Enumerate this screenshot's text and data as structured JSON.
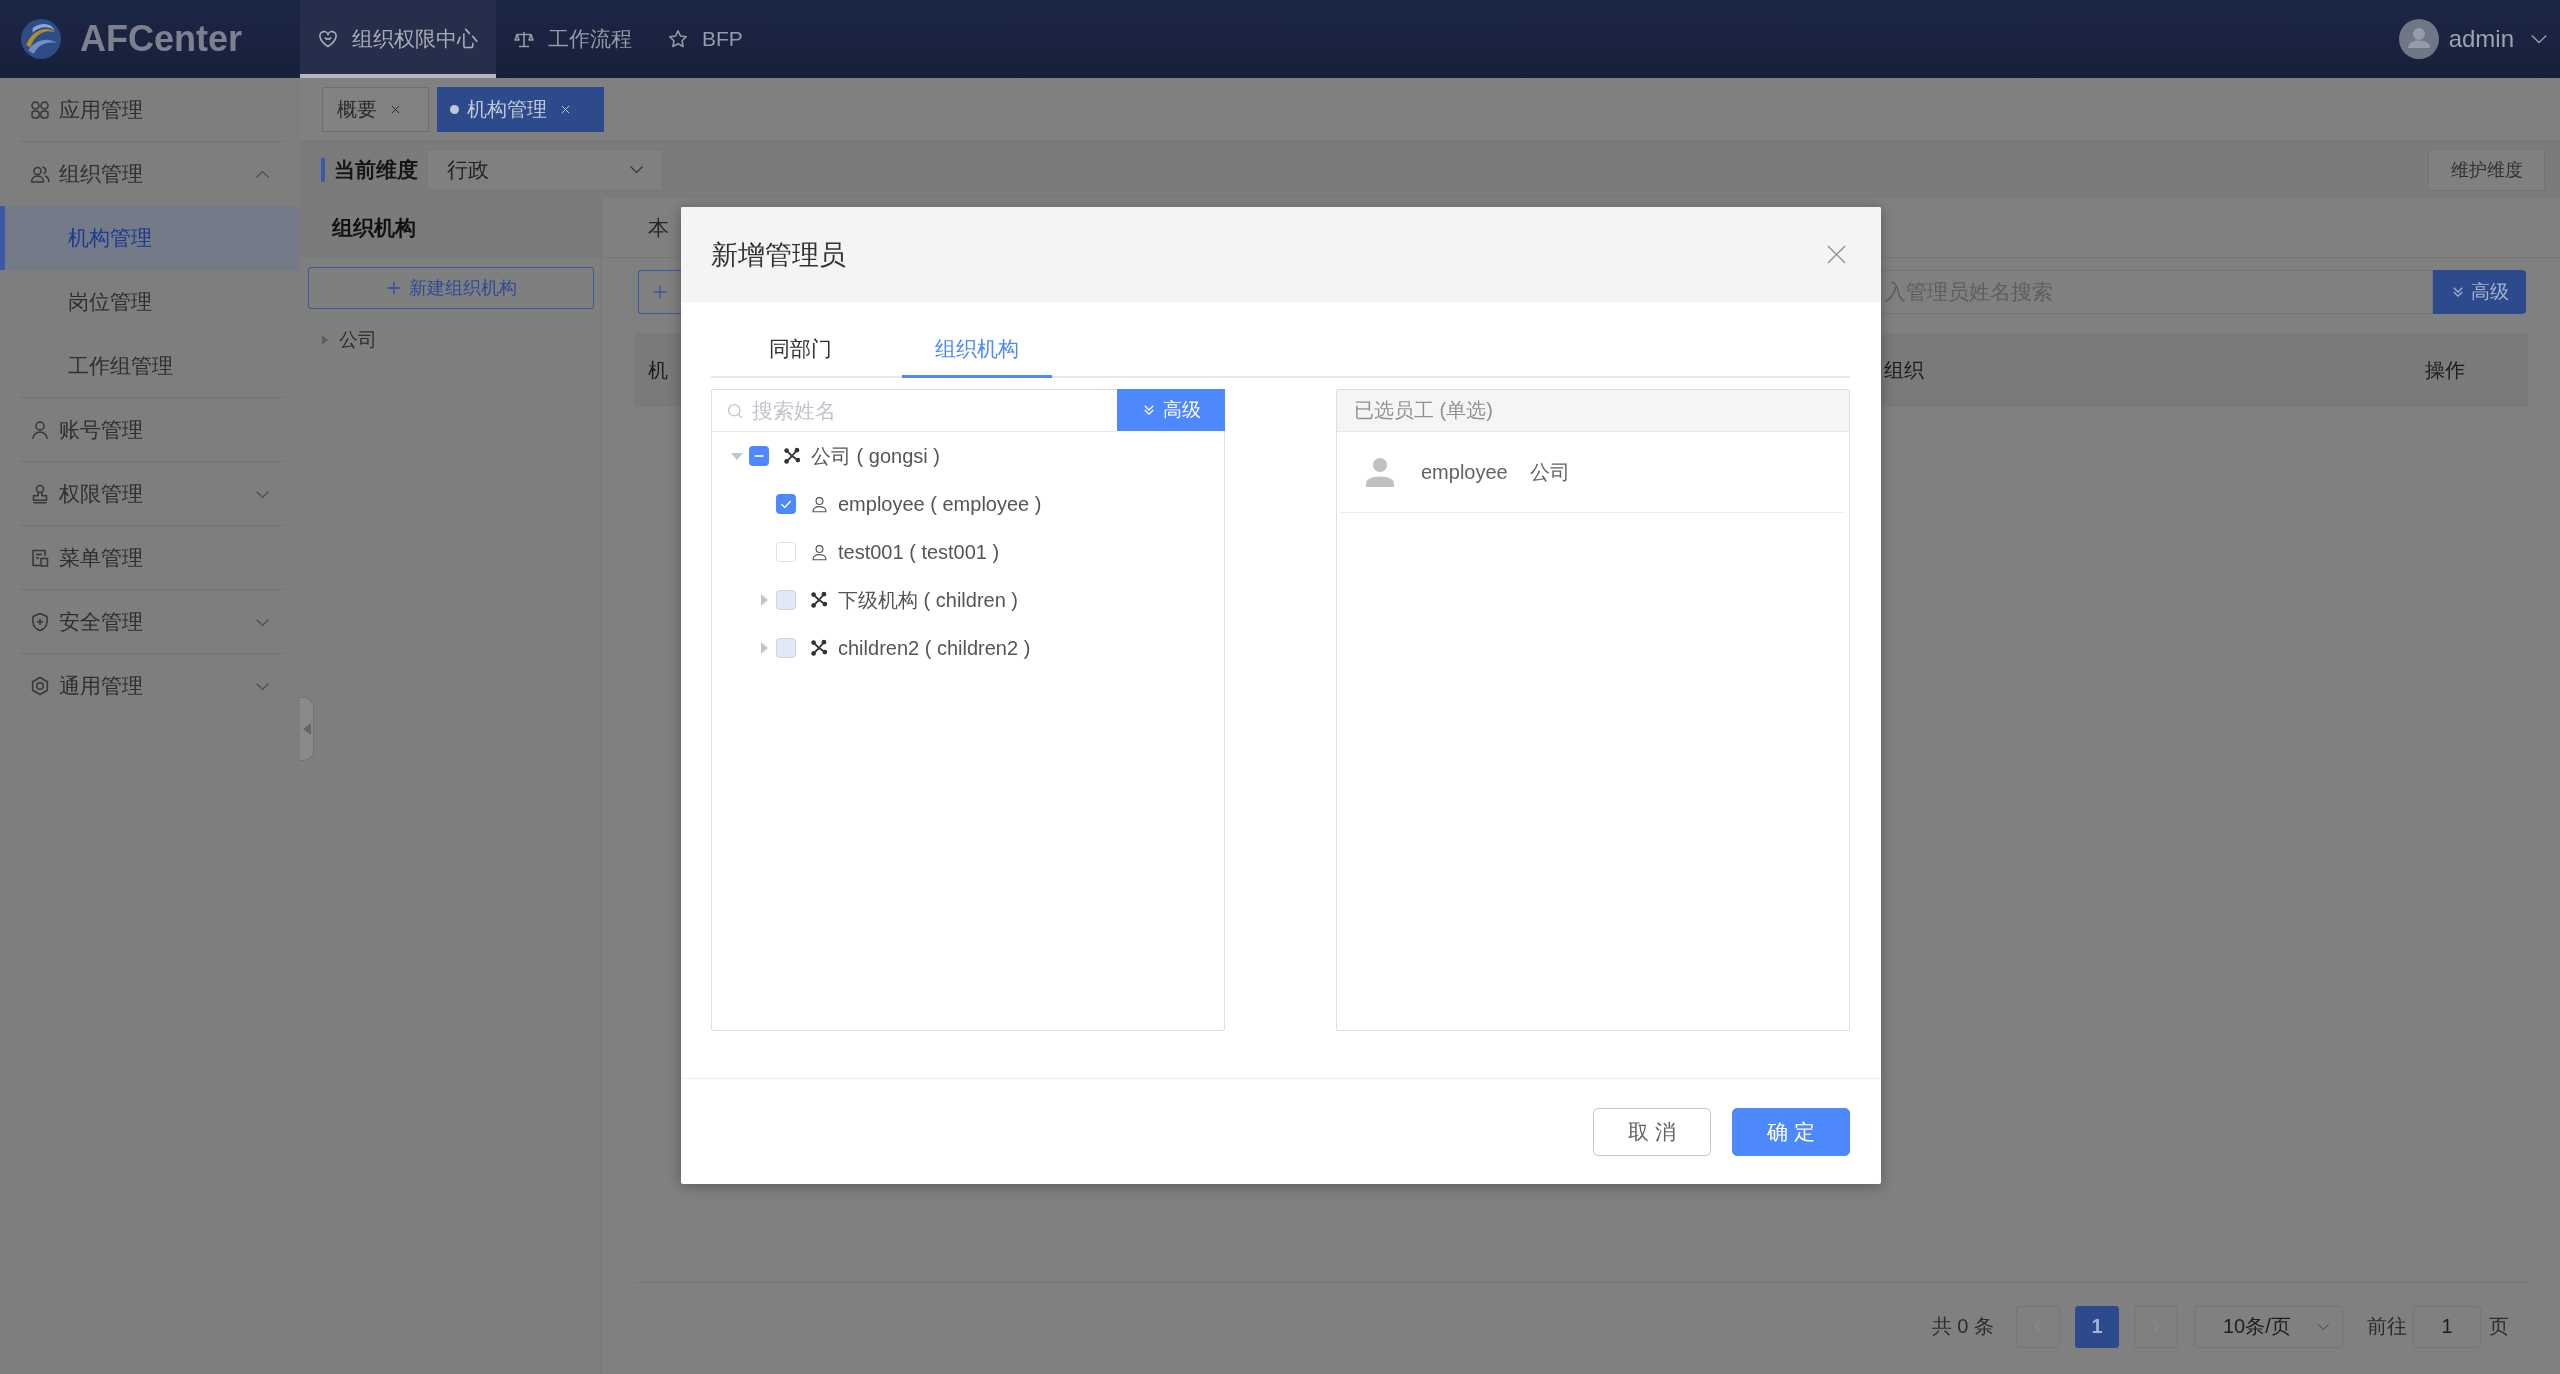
{
  "header": {
    "logo_text": "AFCenter",
    "nav": [
      {
        "label": "组织权限中心",
        "selected": true
      },
      {
        "label": "工作流程",
        "selected": false
      },
      {
        "label": "BFP",
        "selected": false
      }
    ],
    "user": "admin"
  },
  "sidebar": {
    "items": [
      {
        "label": "应用管理",
        "selected": false
      },
      {
        "label": "组织管理",
        "selected": false,
        "expanded": true,
        "children": [
          {
            "label": "机构管理",
            "selected": true
          },
          {
            "label": "岗位管理",
            "selected": false
          },
          {
            "label": "工作组管理",
            "selected": false
          }
        ]
      },
      {
        "label": "账号管理",
        "selected": false
      },
      {
        "label": "权限管理",
        "selected": false,
        "expanded": false
      },
      {
        "label": "菜单管理",
        "selected": false
      },
      {
        "label": "安全管理",
        "selected": false,
        "expanded": false
      },
      {
        "label": "通用管理",
        "selected": false,
        "expanded": false
      }
    ]
  },
  "page_tabs": [
    {
      "label": "概要",
      "selected": false
    },
    {
      "label": "机构管理",
      "selected": true
    }
  ],
  "toolbar": {
    "label": "当前维度",
    "dimension": "行政",
    "button": "维护维度"
  },
  "org_panel": {
    "title": "组织机构",
    "new_button": "新建组织机构",
    "tree": [
      {
        "label": "公司",
        "expanded": false
      }
    ]
  },
  "list_panel": {
    "tab": "本",
    "search": {
      "placeholder": "入管理员姓名搜索"
    },
    "advanced_button": "高级",
    "columns": [
      "机",
      "组织",
      "操作"
    ]
  },
  "pagination": {
    "total": "共 0 条",
    "prev": {
      "disabled": true
    },
    "pages": [
      {
        "label": "1",
        "selected": true
      }
    ],
    "next": {
      "disabled": true
    },
    "page_size": "10条/页",
    "goto_label": "前往",
    "goto_value": "1",
    "goto_suffix": "页"
  },
  "dialog": {
    "title": "新增管理员",
    "tabs": [
      {
        "label": "同部门",
        "selected": false
      },
      {
        "label": "组织机构",
        "selected": true
      }
    ],
    "search": {
      "placeholder": "搜索姓名"
    },
    "advanced_button": "高级",
    "tree": [
      {
        "kind": "org",
        "label": "公司 ( gongsi )",
        "expanded": true,
        "checked": false,
        "indeterminate": true,
        "disabled": false,
        "children": [
          {
            "kind": "person",
            "label": "employee ( employee )",
            "checked": true,
            "indeterminate": false,
            "disabled": false
          },
          {
            "kind": "person",
            "label": "test001 ( test001 )",
            "checked": false,
            "indeterminate": false,
            "disabled": false
          },
          {
            "kind": "org",
            "label": "下级机构 ( children )",
            "expanded": false,
            "checked": false,
            "indeterminate": false,
            "disabled": true
          },
          {
            "kind": "org",
            "label": "children2 ( children2 )",
            "expanded": false,
            "checked": false,
            "indeterminate": false,
            "disabled": true
          }
        ]
      }
    ],
    "selected_panel": {
      "title": "已选员工 (单选)",
      "items": [
        {
          "name": "employee",
          "org": "公司"
        }
      ]
    },
    "buttons": [
      {
        "label": "取消",
        "kind": "default"
      },
      {
        "label": "确定",
        "kind": "primary"
      }
    ]
  }
}
